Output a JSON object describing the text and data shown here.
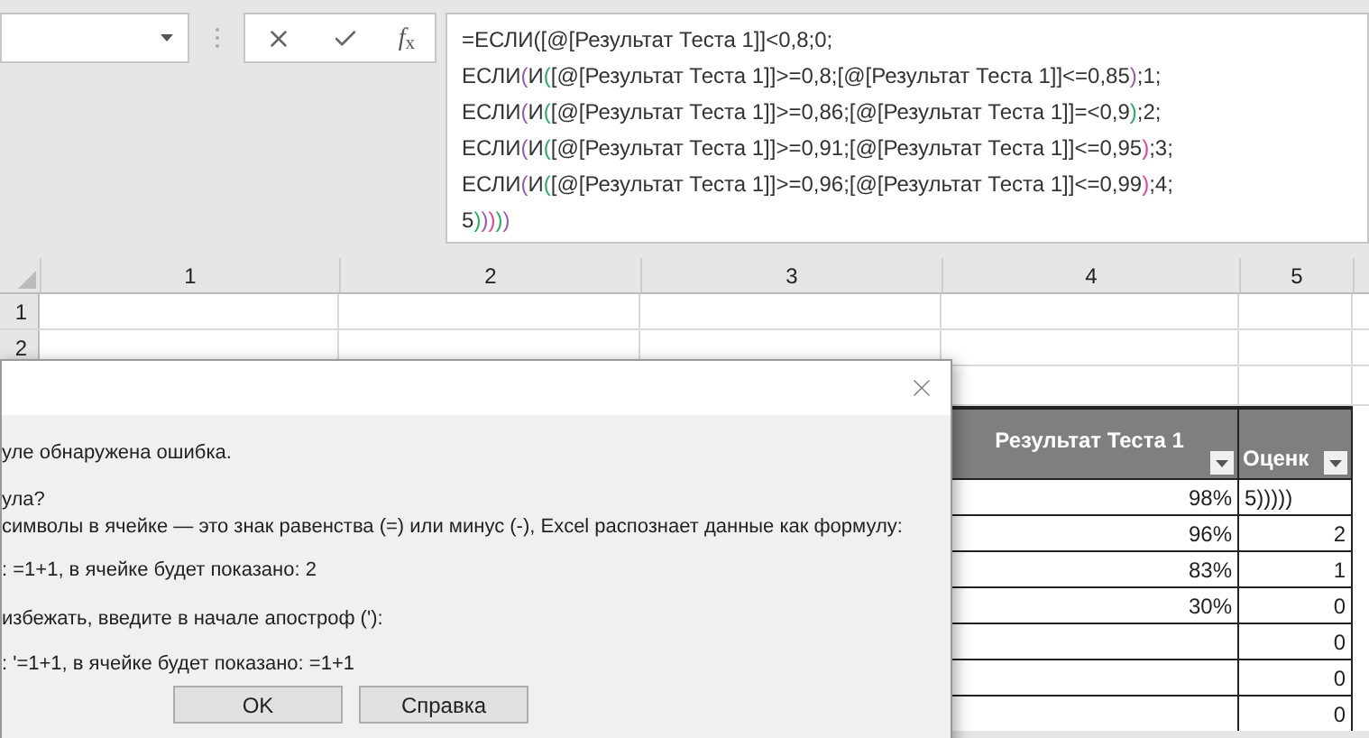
{
  "formula_bar": {
    "function_label": "*f*$_{x}$",
    "lines": [
      [
        {
          "text": "=ЕСЛИ([@[Результат Теста 1]]<0,8;0;",
          "color": "#333333"
        }
      ],
      [
        {
          "text": "ЕСЛИ",
          "color": "#333333"
        },
        {
          "text": "(",
          "color": "#9b59b6"
        },
        {
          "text": "И",
          "color": "#333333"
        },
        {
          "text": "(",
          "color": "#27ae60"
        },
        {
          "text": "[@[Результат Теста 1]]>=0,8;[@[Результат Теста 1]]<=0,85",
          "color": "#333333"
        },
        {
          "text": ")",
          "color": "#9b59b6"
        },
        {
          "text": ";1;",
          "color": "#333333"
        }
      ],
      [
        {
          "text": "ЕСЛИ",
          "color": "#333333"
        },
        {
          "text": "(",
          "color": "#9b59b6"
        },
        {
          "text": "И",
          "color": "#333333"
        },
        {
          "text": "(",
          "color": "#27ae60"
        },
        {
          "text": "[@[Результат Теста 1]]>=0,86;[@[Результат Теста 1]]=<0,9",
          "color": "#333333"
        },
        {
          "text": ")",
          "color": "#27ae60"
        },
        {
          "text": ";2;",
          "color": "#333333"
        }
      ],
      [
        {
          "text": "ЕСЛИ",
          "color": "#333333"
        },
        {
          "text": "(",
          "color": "#9b59b6"
        },
        {
          "text": "И",
          "color": "#333333"
        },
        {
          "text": "(",
          "color": "#27ae60"
        },
        {
          "text": "[@[Результат Теста 1]]>=0,91;[@[Результат Теста 1]]<=0,95",
          "color": "#333333"
        },
        {
          "text": ")",
          "color": "#e84393"
        },
        {
          "text": ";3;",
          "color": "#333333"
        }
      ],
      [
        {
          "text": "ЕСЛИ",
          "color": "#333333"
        },
        {
          "text": "(",
          "color": "#9b59b6"
        },
        {
          "text": "И",
          "color": "#333333"
        },
        {
          "text": "(",
          "color": "#27ae60"
        },
        {
          "text": "[@[Результат Теста 1]]>=0,96;[@[Результат Теста 1]]<=0,99",
          "color": "#333333"
        },
        {
          "text": ")",
          "color": "#e84393"
        },
        {
          "text": ";4;",
          "color": "#333333"
        }
      ],
      [
        {
          "text": "5",
          "color": "#333333"
        },
        {
          "text": ")",
          "color": "#27ae60"
        },
        {
          "text": ")",
          "color": "#9b59b6"
        },
        {
          "text": ")",
          "color": "#e84393"
        },
        {
          "text": ")",
          "color": "#27ae60"
        },
        {
          "text": ")",
          "color": "#9b59b6"
        }
      ]
    ]
  },
  "sheet": {
    "columns": [
      "1",
      "2",
      "3",
      "4",
      "5"
    ],
    "row_headers": [
      "1",
      "2"
    ]
  },
  "table": {
    "columns": [
      "Результат Теста 1",
      "Оценк"
    ],
    "rows": [
      [
        "98%",
        "5)))))"
      ],
      [
        "96%",
        "2"
      ],
      [
        "83%",
        "1"
      ],
      [
        "30%",
        "0"
      ],
      [
        "",
        "0"
      ],
      [
        "",
        "0"
      ],
      [
        "",
        "0"
      ]
    ]
  },
  "dialog": {
    "lines": [
      "уле обнаружена ошибка.",
      "ула?",
      "символы в ячейке — это знак равенства (=) или минус (-), Excel распознает данные как формулу:",
      ": =1+1, в ячейке будет показано: 2",
      "избежать, введите в начале апостроф ('):",
      ": '=1+1, в ячейке будет показано: =1+1"
    ],
    "buttons": [
      "OK",
      "Справка"
    ]
  }
}
